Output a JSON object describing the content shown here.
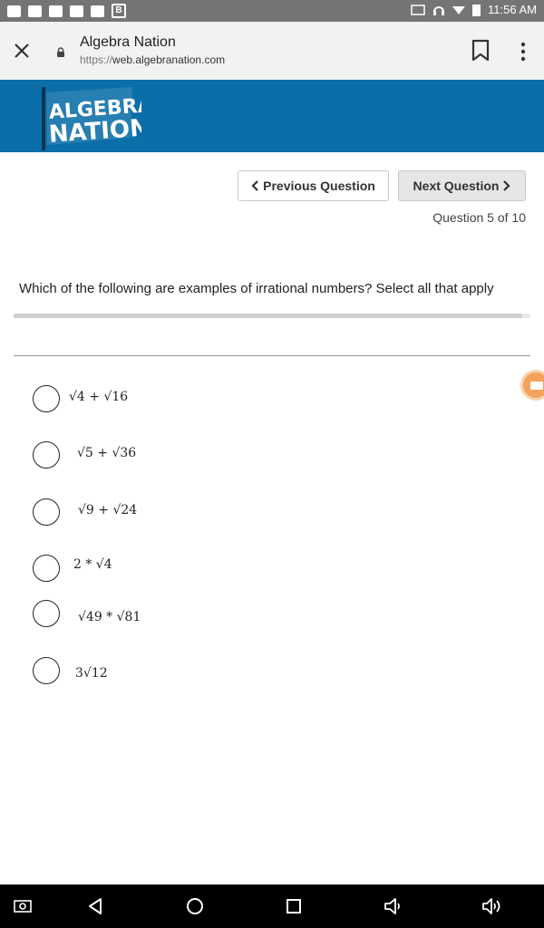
{
  "status_bar": {
    "time": "11:56 AM"
  },
  "browser": {
    "title": "Algebra Nation",
    "url_protocol": "https://",
    "url_host": "web.algebranation.com"
  },
  "banner": {
    "logo_line1": "ALGEBRA",
    "logo_line2": "NATION",
    "color": "#0a6ea8"
  },
  "nav": {
    "prev_label": "Previous Question",
    "next_label": "Next Question",
    "counter": "Question 5 of 10"
  },
  "question": {
    "text": "Which of the following are examples of irrational numbers? Select all that apply",
    "options": [
      "√4 + √16",
      "√5 + √36",
      "√9 + √24",
      "2 * √4",
      "√49 * √81",
      "3√12"
    ]
  },
  "icons": {
    "close": "close-icon",
    "lock": "lock-icon",
    "bookmark": "bookmark-icon",
    "menu": "more-vert-icon",
    "back": "back-icon",
    "home": "home-icon",
    "recents": "recents-icon",
    "screenshot": "screenshot-icon",
    "volume_down": "volume-down-icon",
    "volume_up": "volume-up-icon"
  }
}
